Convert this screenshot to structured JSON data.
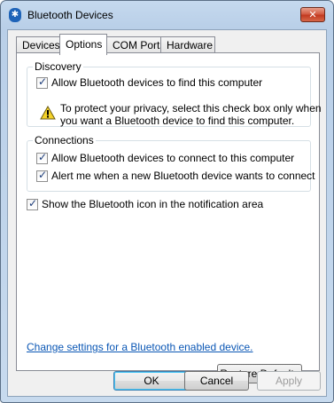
{
  "window": {
    "title": "Bluetooth Devices",
    "close_glyph": "✕",
    "app_icon_glyph": "✱"
  },
  "tabs": [
    {
      "label": "Devices"
    },
    {
      "label": "Options"
    },
    {
      "label": "COM Ports"
    },
    {
      "label": "Hardware"
    }
  ],
  "discovery": {
    "title": "Discovery",
    "allow_find_label": "Allow Bluetooth devices to find this computer",
    "allow_find_checked": true,
    "warning_text": "To protect your privacy, select this check box only when you want a Bluetooth device to find this computer."
  },
  "connections": {
    "title": "Connections",
    "allow_connect_label": "Allow Bluetooth devices to connect to this computer",
    "allow_connect_checked": true,
    "alert_label": "Alert me when a new Bluetooth device wants to connect",
    "alert_checked": true
  },
  "show_icon": {
    "label": "Show the Bluetooth icon in the notification area",
    "checked": true
  },
  "link_text": "Change settings for a Bluetooth enabled device.",
  "buttons": {
    "restore_defaults": "Restore Defaults",
    "ok": "OK",
    "cancel": "Cancel",
    "apply": "Apply"
  },
  "icons": {
    "warning": "warning-icon",
    "bluetooth": "bluetooth-icon"
  },
  "colors": {
    "link": "#0b57b5",
    "warning_fill": "#f4d22a",
    "close_button": "#c23a20"
  }
}
